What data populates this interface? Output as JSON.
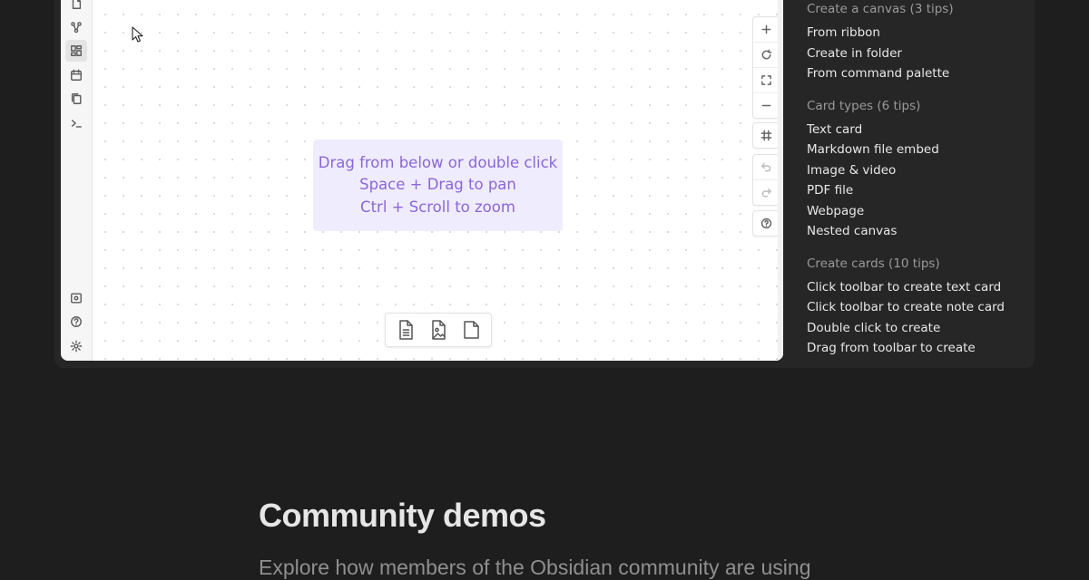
{
  "app": {
    "ribbon": {
      "top_icons": [
        "new-note-icon",
        "graph-view-icon",
        "canvas-icon",
        "daily-note-icon",
        "templates-icon",
        "command-palette-icon"
      ],
      "bottom_icons": [
        "vault-icon",
        "help-icon",
        "settings-icon"
      ],
      "active_icon": "canvas-icon"
    },
    "canvas": {
      "hint_lines": [
        "Drag from below or double click",
        "Space + Drag to pan",
        "Ctrl + Scroll to zoom"
      ],
      "controls": [
        "zoom-in",
        "reset-zoom",
        "zoom-to-fit",
        "zoom-out",
        "snap-to-grid",
        "undo",
        "redo",
        "help"
      ],
      "bottom_toolbar": [
        "new-text-card-icon",
        "new-media-card-icon",
        "new-note-card-icon"
      ]
    }
  },
  "tips": {
    "sections": [
      {
        "heading": "Create a canvas (3 tips)",
        "items": [
          "From ribbon",
          "Create in folder",
          "From command palette"
        ]
      },
      {
        "heading": "Card types (6 tips)",
        "items": [
          "Text card",
          "Markdown file embed",
          "Image & video",
          "PDF file",
          "Webpage",
          "Nested canvas"
        ]
      },
      {
        "heading": "Create cards (10 tips)",
        "items": [
          "Click toolbar to create text card",
          "Click toolbar to create note card",
          "Double click to create",
          "Drag from toolbar to create"
        ]
      }
    ]
  },
  "community": {
    "title": "Community demos",
    "description": "Explore how members of the Obsidian community are using"
  },
  "colors": {
    "page_bg": "#1e1e1e",
    "panel_bg": "#262626",
    "hint_bg": "#efecfe",
    "hint_text": "#8a67d6"
  }
}
